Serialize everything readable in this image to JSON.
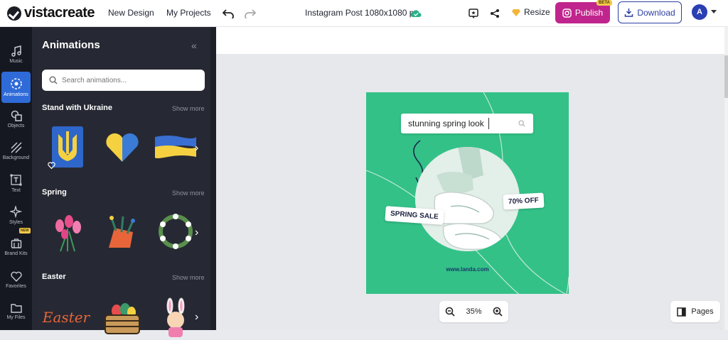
{
  "header": {
    "logo_text": "vistacreate",
    "new_design": "New Design",
    "my_projects": "My Projects",
    "doc_title": "Instagram Post 1080x1080 px",
    "resize": "Resize",
    "publish": "Publish",
    "publish_badge": "BETA",
    "download": "Download",
    "avatar_initial": "A"
  },
  "rail": {
    "items": [
      {
        "label": "Music",
        "icon": "music-note-icon"
      },
      {
        "label": "Animations",
        "icon": "animation-icon",
        "active": true
      },
      {
        "label": "Objects",
        "icon": "objects-icon"
      },
      {
        "label": "Background",
        "icon": "background-icon"
      },
      {
        "label": "Text",
        "icon": "text-icon"
      },
      {
        "label": "Styles",
        "icon": "sparkle-icon",
        "badge": "NEW"
      },
      {
        "label": "Brand Kits",
        "icon": "briefcase-icon"
      },
      {
        "label": "Favorites",
        "icon": "heart-icon"
      },
      {
        "label": "My Files",
        "icon": "folder-icon"
      }
    ]
  },
  "panel": {
    "title": "Animations",
    "search_placeholder": "Search animations...",
    "sections": [
      {
        "title": "Stand with Ukraine",
        "show_more": "Show more"
      },
      {
        "title": "Spring",
        "show_more": "Show more"
      },
      {
        "title": "Easter",
        "show_more": "Show more"
      }
    ],
    "easter_thumb_text": "Easter"
  },
  "artboard": {
    "search_text": "stunning spring look",
    "tag_spring": "SPRING SALE",
    "tag_off": "70% OFF",
    "url": "www.landa.com"
  },
  "zoom": {
    "level": "35%"
  },
  "pages": {
    "label": "Pages"
  },
  "colors": {
    "publish": "#c0258d",
    "download_border": "#2c3fa3",
    "artboard_bg": "#33c188",
    "rail_active": "#2f6bd8",
    "panel_bg": "#262933"
  }
}
